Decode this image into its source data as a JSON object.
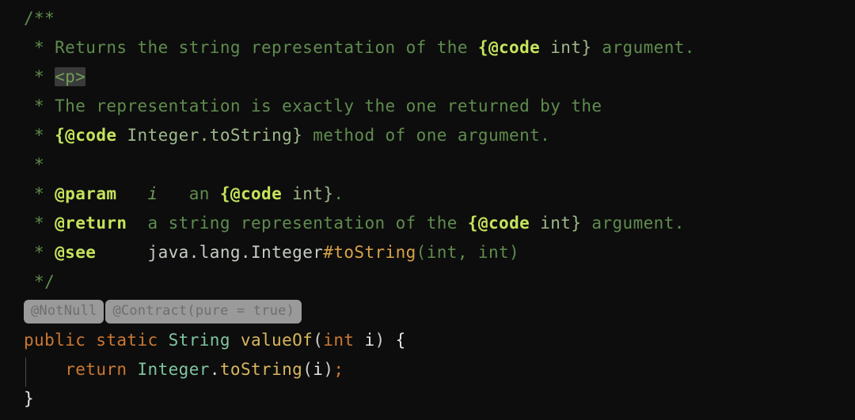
{
  "editor": {
    "language": "java",
    "background_color": "#0d0d0d",
    "comment_color": "#5f8c4e",
    "tag_color": "#c5e35b",
    "keyword_color": "#cc7832",
    "type_color": "#7fc4a0",
    "method_color": "#d8b65c",
    "hint_background_color": "#9a9a9a",
    "hint_text_color": "#6e6e6e",
    "highlight_background_color": "#3a3a3a"
  },
  "javadoc": {
    "open": "/**",
    "close": " */",
    "asterisk": " * ",
    "line1": {
      "text_before": "Returns the string representation of the ",
      "code_tag": "{@code",
      "code_body": " int}",
      "text_after": " argument."
    },
    "line2": {
      "html_tag": "<p>"
    },
    "line3": {
      "text": "The representation is exactly the one returned by the"
    },
    "line4": {
      "code_tag": "{@code",
      "code_body": " Integer.toString}",
      "text_after": " method of one argument."
    },
    "line_blank": "",
    "param": {
      "tag": "@param",
      "spacer1": "   ",
      "name": "i",
      "spacer2": "   ",
      "text_before": "an ",
      "code_tag": "{@code",
      "code_body": " int}",
      "text_after": "."
    },
    "returns": {
      "tag": "@return",
      "spacer": "  ",
      "text_before": "a string representation of the ",
      "code_tag": "{@code",
      "code_body": " int}",
      "text_after": " argument."
    },
    "see": {
      "tag": "@see",
      "spacer": "     ",
      "reference": "java.lang.Integer",
      "member": "#toString",
      "signature": "(int, int)"
    }
  },
  "inlay_hints": [
    {
      "label": "@NotNull"
    },
    {
      "label": "@Contract(pure = true)"
    }
  ],
  "signature": {
    "modifiers": "public static",
    "space1": " ",
    "return_type": "String",
    "space2": " ",
    "method_name": "valueOf",
    "paren_open": "(",
    "param_type": "int",
    "space3": " ",
    "param_name": "i",
    "paren_close": ")",
    "brace_open": " {"
  },
  "body": {
    "indent": "    ",
    "keyword": "return",
    "space": " ",
    "receiver": "Integer",
    "dot": ".",
    "method": "toString",
    "paren_open": "(",
    "argument": "i",
    "paren_close": ")",
    "semicolon": ";"
  },
  "closing_brace": "}"
}
